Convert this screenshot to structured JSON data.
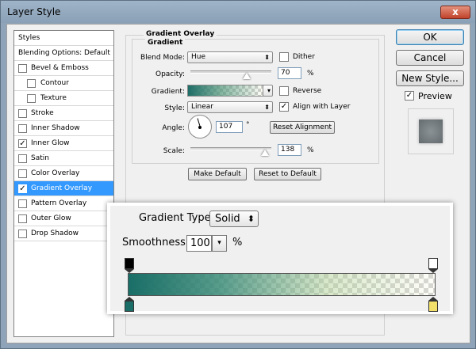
{
  "window": {
    "title": "Layer Style",
    "close_glyph": "x"
  },
  "styles_panel": {
    "header": "Styles",
    "blending": "Blending Options: Default",
    "items": [
      {
        "label": "Bevel & Emboss",
        "checked": false
      },
      {
        "label": "Contour",
        "checked": false,
        "sub": true
      },
      {
        "label": "Texture",
        "checked": false,
        "sub": true
      },
      {
        "label": "Stroke",
        "checked": false
      },
      {
        "label": "Inner Shadow",
        "checked": false
      },
      {
        "label": "Inner Glow",
        "checked": true
      },
      {
        "label": "Satin",
        "checked": false
      },
      {
        "label": "Color Overlay",
        "checked": false
      },
      {
        "label": "Gradient Overlay",
        "checked": true,
        "selected": true
      },
      {
        "label": "Pattern Overlay",
        "checked": false
      },
      {
        "label": "Outer Glow",
        "checked": false
      },
      {
        "label": "Drop Shadow",
        "checked": false
      }
    ]
  },
  "gradient_overlay": {
    "group_title": "Gradient Overlay",
    "section_title": "Gradient",
    "blend_mode_label": "Blend Mode:",
    "blend_mode": "Hue",
    "dither_label": "Dither",
    "dither_checked": false,
    "opacity_label": "Opacity:",
    "opacity": "70",
    "opacity_unit": "%",
    "opacity_fraction": 0.7,
    "gradient_label": "Gradient:",
    "reverse_label": "Reverse",
    "reverse_checked": false,
    "style_label": "Style:",
    "style": "Linear",
    "align_label": "Align with Layer",
    "align_checked": true,
    "angle_label": "Angle:",
    "angle": "107",
    "angle_unit": "°",
    "reset_alignment": "Reset Alignment",
    "scale_label": "Scale:",
    "scale": "138",
    "scale_unit": "%",
    "scale_fraction": 0.92,
    "make_default": "Make Default",
    "reset_default": "Reset to Default"
  },
  "right_column": {
    "ok": "OK",
    "cancel": "Cancel",
    "new_style": "New Style...",
    "preview_label": "Preview",
    "preview_checked": true
  },
  "callout": {
    "gradient_type_label": "Gradient Type:",
    "gradient_type": "Solid",
    "smoothness_label": "Smoothness:",
    "smoothness": "100",
    "smoothness_unit": "%",
    "colors": {
      "start": "#1a6e67",
      "end": "#f2e06a"
    }
  }
}
